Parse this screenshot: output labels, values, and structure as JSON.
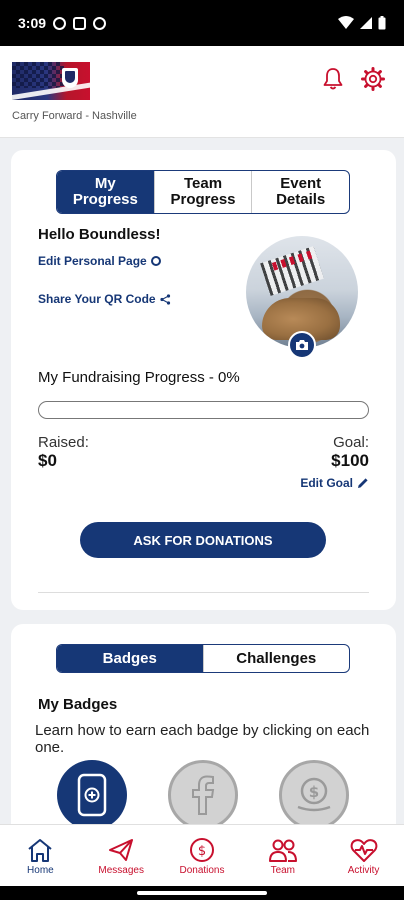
{
  "status_bar": {
    "time": "3:09"
  },
  "header": {
    "subtitle": "Carry Forward - Nashville"
  },
  "tabs": [
    {
      "label": "My\nProgress",
      "active": true
    },
    {
      "label": "Team\nProgress",
      "active": false
    },
    {
      "label": "Event\nDetails",
      "active": false
    }
  ],
  "profile": {
    "greeting": "Hello Boundless!",
    "edit_page_link": "Edit Personal Page",
    "qr_link": "Share Your QR Code"
  },
  "fundraising": {
    "title": "My Fundraising Progress - 0%",
    "progress_fraction": 0,
    "raised_label": "Raised:",
    "raised_value": "$0",
    "goal_label": "Goal:",
    "goal_value": "$100",
    "edit_goal": "Edit Goal",
    "ask_button": "ASK FOR DONATIONS"
  },
  "badge_tabs": [
    {
      "label": "Badges",
      "active": true
    },
    {
      "label": "Challenges",
      "active": false
    }
  ],
  "badges": {
    "heading": "My Badges",
    "description": "Learn how to earn each badge by clicking on each one.",
    "items": [
      {
        "icon": "mobile-app-icon",
        "earned": true
      },
      {
        "icon": "facebook-icon",
        "earned": false
      },
      {
        "icon": "money-icon",
        "earned": false
      }
    ]
  },
  "nav": [
    {
      "label": "Home",
      "icon": "home-icon",
      "active": true
    },
    {
      "label": "Messages",
      "icon": "paper-plane-icon",
      "active": false
    },
    {
      "label": "Donations",
      "icon": "dollar-circle-icon",
      "active": false
    },
    {
      "label": "Team",
      "icon": "team-icon",
      "active": false
    },
    {
      "label": "Activity",
      "icon": "heart-pulse-icon",
      "active": false
    }
  ],
  "colors": {
    "primary": "#163776",
    "accent": "#c8102e"
  }
}
